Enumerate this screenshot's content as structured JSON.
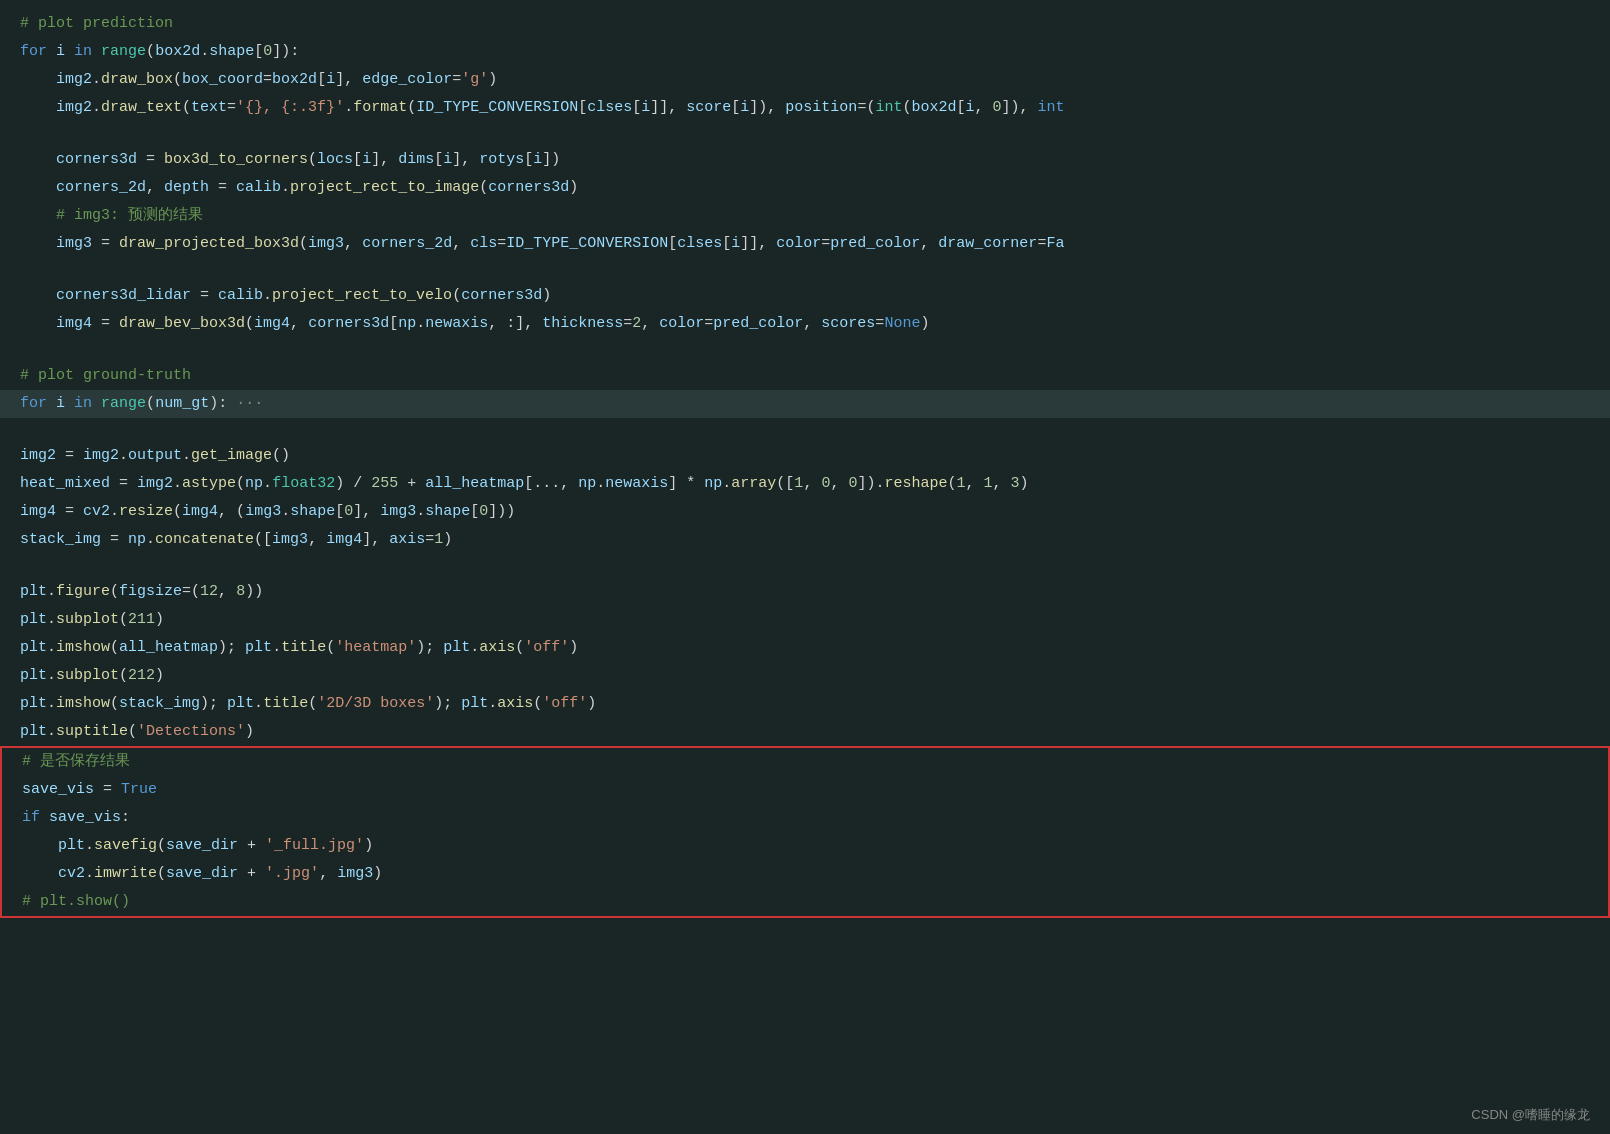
{
  "footer": "CSDN @嗜睡的缘龙",
  "code_lines": [
    {
      "id": 1,
      "text": "# plot prediction",
      "type": "comment"
    },
    {
      "id": 2,
      "text": "for i in range(box2d.shape[0]):",
      "type": "code"
    },
    {
      "id": 3,
      "text": "    img2.draw_box(box_coord=box2d[i], edge_color='g')",
      "type": "code"
    },
    {
      "id": 4,
      "text": "    img2.draw_text(text='{}, {:.3f}'.format(ID_TYPE_CONVERSION[clses[i]], score[i]), position=(int(box2d[i, 0]), int",
      "type": "code"
    },
    {
      "id": 5,
      "text": "",
      "type": "empty"
    },
    {
      "id": 6,
      "text": "    corners3d = box3d_to_corners(locs[i], dims[i], rotys[i])",
      "type": "code"
    },
    {
      "id": 7,
      "text": "    corners_2d, depth = calib.project_rect_to_image(corners3d)",
      "type": "code"
    },
    {
      "id": 8,
      "text": "    # img3: 预测的结果",
      "type": "comment"
    },
    {
      "id": 9,
      "text": "    img3 = draw_projected_box3d(img3, corners_2d, cls=ID_TYPE_CONVERSION[clses[i]], color=pred_color, draw_corner=Fa",
      "type": "code"
    },
    {
      "id": 10,
      "text": "",
      "type": "empty"
    },
    {
      "id": 11,
      "text": "    corners3d_lidar = calib.project_rect_to_velo(corners3d)",
      "type": "code"
    },
    {
      "id": 12,
      "text": "    img4 = draw_bev_box3d(img4, corners3d[np.newaxis, :], thickness=2, color=pred_color, scores=None)",
      "type": "code"
    },
    {
      "id": 13,
      "text": "",
      "type": "empty"
    },
    {
      "id": 14,
      "text": "# plot ground-truth",
      "type": "comment"
    },
    {
      "id": 15,
      "text": "for i in range(num_gt): ···",
      "type": "code_highlighted"
    },
    {
      "id": 16,
      "text": "",
      "type": "empty"
    },
    {
      "id": 17,
      "text": "img2 = img2.output.get_image()",
      "type": "code"
    },
    {
      "id": 18,
      "text": "heat_mixed = img2.astype(np.float32) / 255 + all_heatmap[..., np.newaxis] * np.array([1, 0, 0]).reshape(1, 1, 3)",
      "type": "code"
    },
    {
      "id": 19,
      "text": "img4 = cv2.resize(img4, (img3.shape[0], img3.shape[0]))",
      "type": "code"
    },
    {
      "id": 20,
      "text": "stack_img = np.concatenate([img3, img4], axis=1)",
      "type": "code"
    },
    {
      "id": 21,
      "text": "",
      "type": "empty"
    },
    {
      "id": 22,
      "text": "plt.figure(figsize=(12, 8))",
      "type": "code"
    },
    {
      "id": 23,
      "text": "plt.subplot(211)",
      "type": "code"
    },
    {
      "id": 24,
      "text": "plt.imshow(all_heatmap); plt.title('heatmap'); plt.axis('off')",
      "type": "code"
    },
    {
      "id": 25,
      "text": "plt.subplot(212)",
      "type": "code"
    },
    {
      "id": 26,
      "text": "plt.imshow(stack_img); plt.title('2D/3D boxes'); plt.axis('off')",
      "type": "code"
    },
    {
      "id": 27,
      "text": "plt.suptitle('Detections')",
      "type": "code"
    },
    {
      "id": 28,
      "text": "# 是否保存结果",
      "type": "comment_block_start"
    },
    {
      "id": 29,
      "text": "save_vis = True",
      "type": "code_block"
    },
    {
      "id": 30,
      "text": "if save_vis:",
      "type": "code_block"
    },
    {
      "id": 31,
      "text": "    plt.savefig(save_dir + '_full.jpg')",
      "type": "code_block"
    },
    {
      "id": 32,
      "text": "    cv2.imwrite(save_dir + '.jpg', img3)",
      "type": "code_block"
    },
    {
      "id": 33,
      "text": "# plt.show()",
      "type": "comment_block_end"
    }
  ]
}
